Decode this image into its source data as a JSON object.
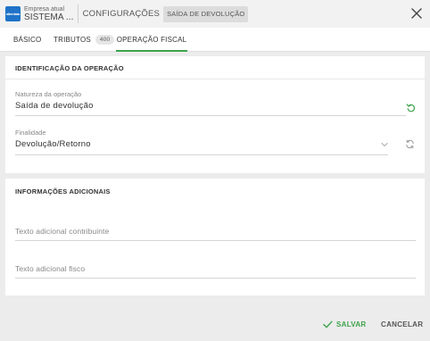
{
  "header": {
    "logo_text": "alterdata",
    "company_label": "Empresa atual",
    "company_name": "SISTEMA ...",
    "section_title": "CONFIGURAÇÕES",
    "breadcrumb_badge": "SAÍDA DE DEVOLUÇÃO"
  },
  "tabs": [
    {
      "label": "BÁSICO",
      "active": false
    },
    {
      "label": "TRIBUTOS",
      "count": "400",
      "active": false
    },
    {
      "label": "OPERAÇÃO FISCAL",
      "active": true
    }
  ],
  "identificacao": {
    "title": "IDENTIFICAÇÃO DA OPERAÇÃO",
    "natureza_label": "Natureza da operação",
    "natureza_value": "Saída de devolução",
    "finalidade_label": "Finalidade",
    "finalidade_value": "Devolução/Retorno"
  },
  "informacoes": {
    "title": "INFORMAÇÕES ADICIONAIS",
    "contribuinte_placeholder": "Texto adicional contribuinte",
    "fisco_placeholder": "Texto adicional fisco"
  },
  "footer": {
    "save_label": "SALVAR",
    "cancel_label": "CANCELAR"
  },
  "colors": {
    "accent": "#3ea34c",
    "logo": "#1f73c8",
    "background": "#ececec"
  }
}
